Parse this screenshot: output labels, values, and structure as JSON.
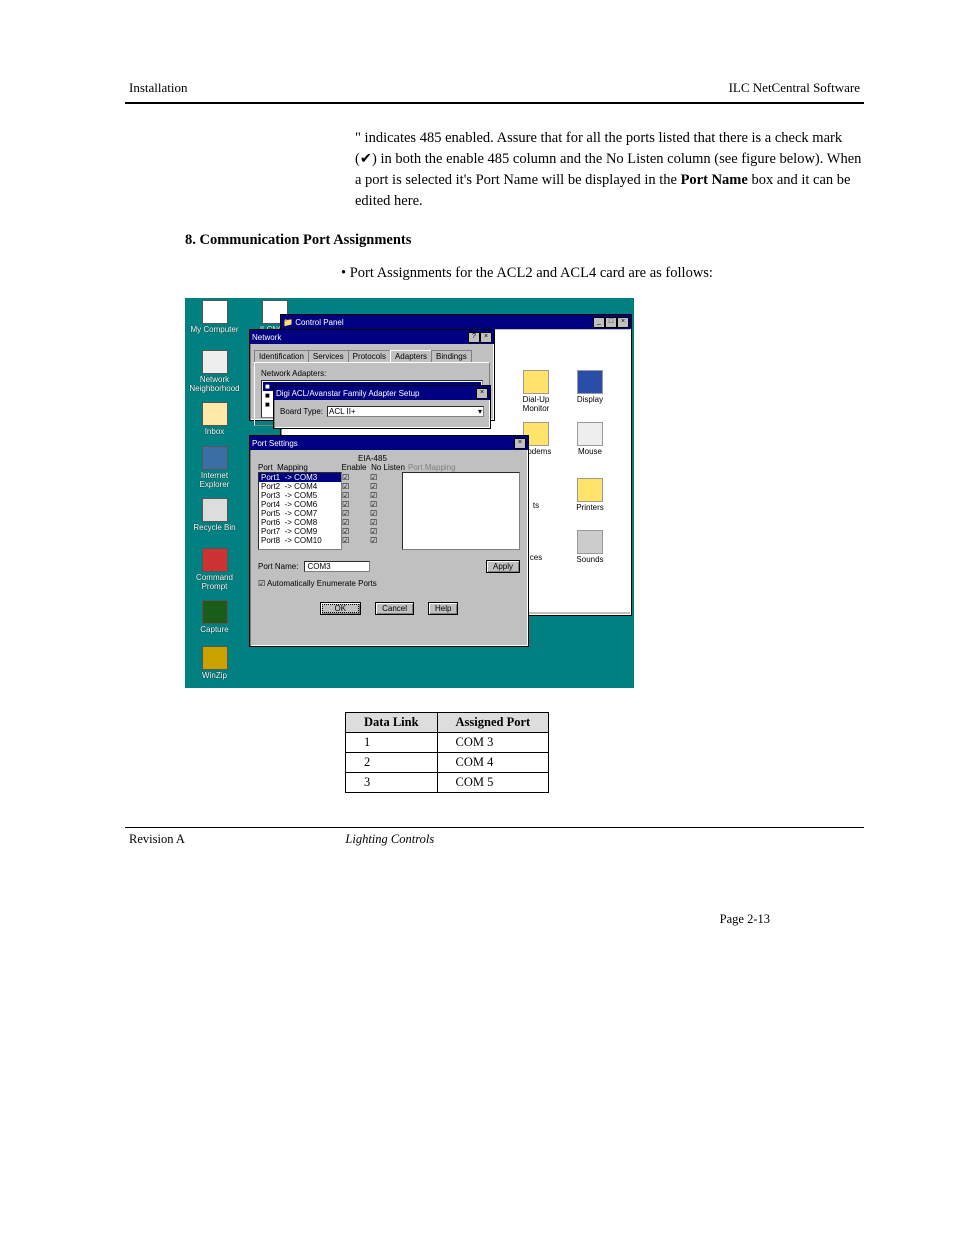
{
  "header": {
    "left": "Installation",
    "right": "ILC NetCentral Software"
  },
  "para1_prefix": "\" indicates 485 enabled. Assure that for all the ports listed that there is a check mark (",
  "para1_middle": ") in both the enable 485 column and the No Listen column (see figure below). When a port is selected it's Port Name will be displayed in the ",
  "para1_field": "Port Name",
  "para1_suffix": " box and it can be edited here.",
  "step8_label": "8. Communication Port Assignments",
  "step8_bullet1": "Port Assignments for the ACL2 and ACL4 card are as follows:",
  "screenshot": {
    "desktop_icons": [
      {
        "label": "My Computer"
      },
      {
        "label": "ILCNCS MINIMAC"
      },
      {
        "label": "Network Neighborhood"
      },
      {
        "label": "Inbox"
      },
      {
        "label": "Internet Explorer"
      },
      {
        "label": "Recycle Bin"
      },
      {
        "label": "Command Prompt"
      },
      {
        "label": "Capture"
      },
      {
        "label": "WinZip"
      }
    ],
    "control_panel": {
      "title": "Control Panel",
      "icons": [
        {
          "label": "Dial-Up Monitor"
        },
        {
          "label": "Display"
        },
        {
          "label": "Modems"
        },
        {
          "label": "Mouse"
        },
        {
          "label": "ts"
        },
        {
          "label": "Printers"
        },
        {
          "label": "ces"
        },
        {
          "label": "Sounds"
        }
      ]
    },
    "network_dialog": {
      "title": "Network",
      "tabs": [
        "Identification",
        "Services",
        "Protocols",
        "Adapters",
        "Bindings"
      ],
      "active_tab": "Adapters",
      "section_label": "Network Adapters:"
    },
    "adapter_setup": {
      "title": "Digi ACL/Avanstar Family Adapter Setup",
      "board_type_label": "Board Type:",
      "board_type_value": "ACL II+"
    },
    "port_settings": {
      "title": "Port Settings",
      "header_group": "EIA-485",
      "columns": [
        "Port",
        "Mapping",
        "Enable",
        "No Listen",
        "Port Mapping"
      ],
      "rows": [
        {
          "port": "Port1",
          "map": "COM3",
          "enable": true,
          "nolisten": true,
          "selected": true
        },
        {
          "port": "Port2",
          "map": "COM4",
          "enable": true,
          "nolisten": true
        },
        {
          "port": "Port3",
          "map": "COM5",
          "enable": true,
          "nolisten": true
        },
        {
          "port": "Port4",
          "map": "COM6",
          "enable": true,
          "nolisten": true
        },
        {
          "port": "Port5",
          "map": "COM7",
          "enable": true,
          "nolisten": true
        },
        {
          "port": "Port6",
          "map": "COM8",
          "enable": true,
          "nolisten": true
        },
        {
          "port": "Port7",
          "map": "COM9",
          "enable": true,
          "nolisten": true
        },
        {
          "port": "Port8",
          "map": "COM10",
          "enable": true,
          "nolisten": true
        }
      ],
      "port_name_label": "Port Name:",
      "port_name_value": "COM3",
      "apply_btn": "Apply",
      "auto_enum": "Automatically Enumerate Ports",
      "auto_enum_checked": true,
      "ok_btn": "OK",
      "cancel_btn": "Cancel",
      "help_btn": "Help"
    }
  },
  "map_table": {
    "headers": [
      "Data Link",
      "Assigned Port"
    ],
    "rows": [
      [
        "1",
        "COM 3"
      ],
      [
        "2",
        "COM 4"
      ],
      [
        "3",
        "COM 5"
      ]
    ]
  },
  "footer": {
    "rev": "Revision A",
    "center": "Lighting Controls",
    "page": "Page 2-13"
  }
}
